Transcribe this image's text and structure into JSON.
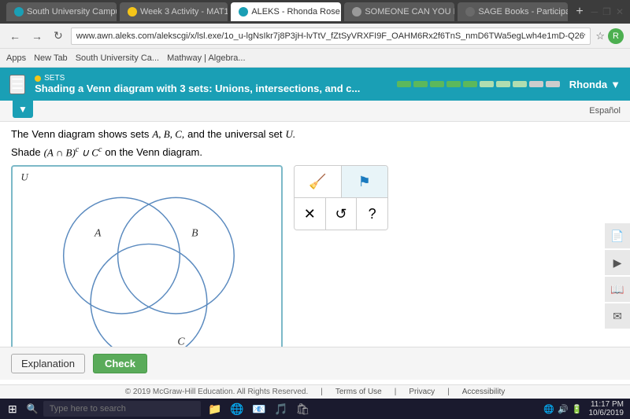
{
  "browser": {
    "tabs": [
      {
        "label": "South University Campu...",
        "favicon_color": "#1a9fb5",
        "active": false
      },
      {
        "label": "Week 3 Activity - MAT1...",
        "favicon_color": "#f5c518",
        "active": false
      },
      {
        "label": "ALEKS - Rhonda Rose -...",
        "favicon_color": "#1a9fb5",
        "active": true
      },
      {
        "label": "SOMEONE CAN YOU PL...",
        "favicon_color": "#999",
        "active": false
      },
      {
        "label": "SAGE Books - Participati...",
        "favicon_color": "#6a6a6a",
        "active": false
      }
    ],
    "address": "www.awn.aleks.com/alekscgi/x/lsl.exe/1o_u-lgNsIkr7j8P3jH-lvTtV_fZtSyVRXFI9F_OAHM6Rx2f6TnS_nmD6TWa5egLwh4e1mD-Q26vJxUlZly8...",
    "bookmarks": [
      "Apps",
      "New Tab",
      "South University Ca...",
      "Mathway | Algebra..."
    ]
  },
  "header": {
    "sets_label": "SETS",
    "topic_title": "Shading a Venn diagram with 3 sets: Unions, intersections, and c...",
    "user_name": "Rhonda",
    "progress_segments": [
      "green",
      "green",
      "green",
      "green",
      "green",
      "light",
      "light",
      "light",
      "light",
      "gray",
      "gray"
    ]
  },
  "espanol_btn": "Español",
  "problem": {
    "line1_prefix": "The",
    "venn_link": "Venn diagram",
    "line1_mid": "shows",
    "sets_link": "sets",
    "sets_letters": "A, B, C,",
    "line1_suffix": "and the",
    "universal_link": "universal set",
    "universal_var": "U.",
    "line2_prefix": "Shade",
    "expression": "(A ∩ B)ᶜ ∪ Cᶜ",
    "line2_suffix": "on the Venn diagram."
  },
  "tools": {
    "eraser_icon": "✏",
    "flag_icon": "⚑",
    "cross_icon": "✕",
    "undo_icon": "↺",
    "help_icon": "?"
  },
  "venn": {
    "label_u": "U",
    "label_a": "A",
    "label_b": "B",
    "label_c": "C"
  },
  "right_sidebar": {
    "icons": [
      "📄",
      "▶",
      "📖",
      "✉"
    ]
  },
  "buttons": {
    "explanation": "Explanation",
    "check": "Check"
  },
  "footer": {
    "copyright": "© 2019 McGraw-Hill Education. All Rights Reserved.",
    "terms": "Terms of Use",
    "privacy": "Privacy",
    "accessibility": "Accessibility"
  },
  "taskbar": {
    "search_placeholder": "Type here to search",
    "time": "11:17 PM",
    "date": "10/6/2019",
    "icons": [
      "⊞",
      "🔍",
      "📁",
      "🌐",
      "📧",
      "🎵",
      "📷"
    ]
  }
}
